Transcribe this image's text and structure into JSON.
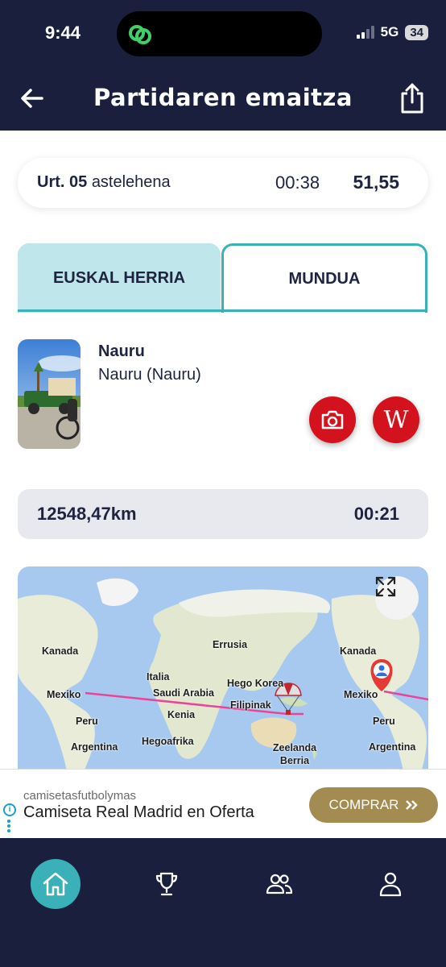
{
  "status_bar": {
    "time": "9:44",
    "network": "5G",
    "battery": "34"
  },
  "header": {
    "title": "Partidaren emaitza",
    "back_icon": "arrow-left-icon",
    "share_icon": "share-icon"
  },
  "result": {
    "date_bold": "Urt. 05",
    "date_rest": "astelehena",
    "time": "00:38",
    "score": "51,55"
  },
  "tabs": [
    {
      "label": "EUSKAL HERRIA",
      "active": false
    },
    {
      "label": "MUNDUA",
      "active": true
    }
  ],
  "place": {
    "name": "Nauru",
    "subtitle": "Nauru (Nauru)",
    "camera_icon": "camera-icon",
    "wiki_label": "W"
  },
  "distance": {
    "km": "12548,47km",
    "time": "00:21"
  },
  "map": {
    "labels": [
      "Kanada",
      "Errusia",
      "Italia",
      "Hego Korea",
      "Saudi Arabia",
      "Mexiko",
      "Filipinak",
      "Peru",
      "Kenia",
      "Argentina",
      "Hegoafrika",
      "Zeelanda Berria",
      "Kanada",
      "Mexiko",
      "Peru",
      "Argentina"
    ],
    "expand_icon": "expand-icon"
  },
  "ad": {
    "source": "camisetasfutbolymas",
    "title": "Camiseta Real Madrid en Oferta",
    "button": "COMPRAR"
  },
  "nav": [
    "home-icon",
    "trophy-icon",
    "group-icon",
    "profile-icon"
  ]
}
